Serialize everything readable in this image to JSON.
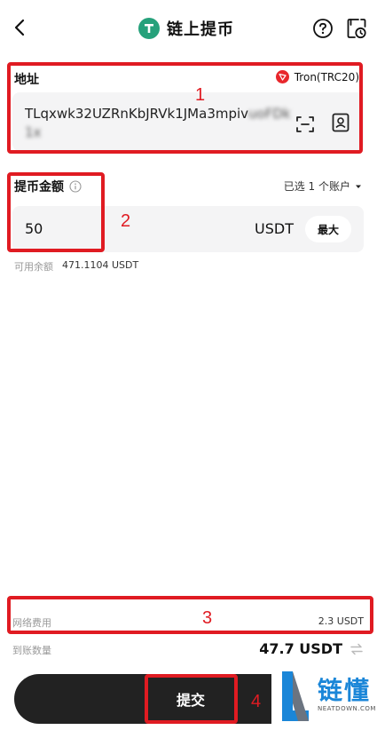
{
  "header": {
    "title": "链上提币"
  },
  "address": {
    "label": "地址",
    "network": "Tron(TRC20)",
    "value_visible": "TLqxwk32UZRnKbJRVk1JMa3mpiv",
    "value_blurred": "uoFDk1x"
  },
  "amount": {
    "label": "提币金额",
    "account_select": "已选 1 个账户",
    "value": "50",
    "unit": "USDT",
    "max_label": "最大",
    "balance_label": "可用余额",
    "balance_value": "471.1104 USDT"
  },
  "fee": {
    "label": "网络费用",
    "value": "2.3 USDT"
  },
  "receive": {
    "label": "到账数量",
    "value": "47.7 USDT"
  },
  "submit": {
    "label": "提交"
  },
  "annotations": [
    "1",
    "2",
    "3",
    "4"
  ],
  "watermark": {
    "text": "链懂",
    "sub": "NEATDOWN.COM"
  },
  "colors": {
    "annotation": "#e01b22",
    "tether": "#26a17b",
    "tron": "#e8272c",
    "watermark": "#1a86d8"
  }
}
